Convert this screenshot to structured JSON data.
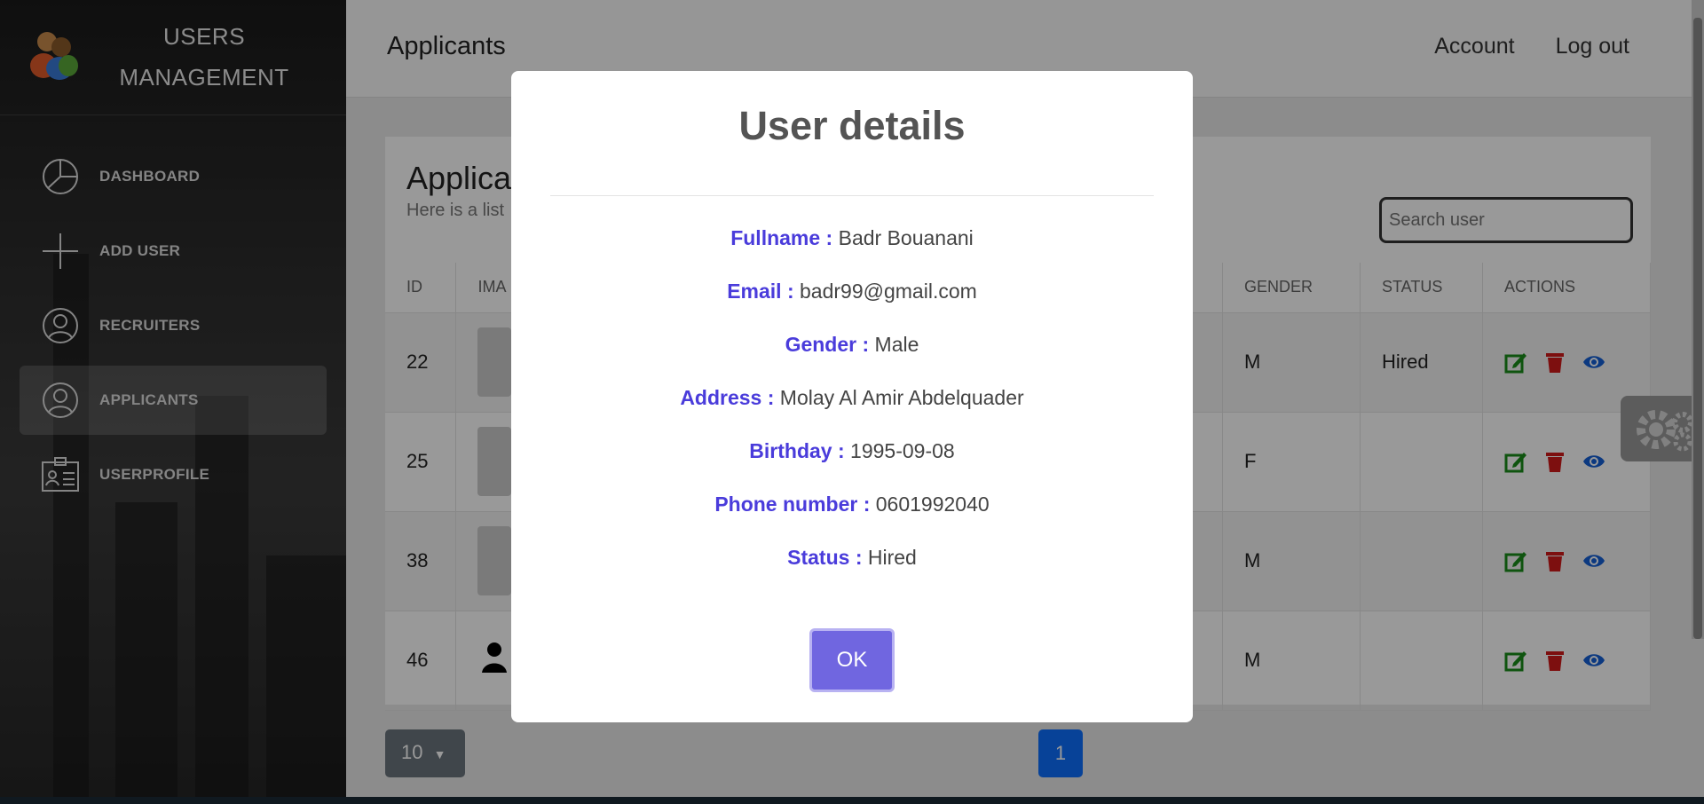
{
  "brand": {
    "line1": "USERS",
    "line2": "MANAGEMENT",
    "logo_icon": "users-group-icon"
  },
  "sidebar": {
    "items": [
      {
        "label": "DASHBOARD",
        "icon": "pie-chart-icon",
        "active": false
      },
      {
        "label": "ADD USER",
        "icon": "plus-icon",
        "active": false
      },
      {
        "label": "RECRUITERS",
        "icon": "user-circle-icon",
        "active": false
      },
      {
        "label": "APPLICANTS",
        "icon": "user-circle-icon",
        "active": true
      },
      {
        "label": "USERPROFILE",
        "icon": "id-card-icon",
        "active": false
      }
    ]
  },
  "header": {
    "title": "Applicants",
    "account": "Account",
    "logout": "Log out"
  },
  "card": {
    "title": "Applica",
    "subtitle": "Here is a list",
    "search_placeholder": "Search user"
  },
  "table": {
    "columns": [
      "ID",
      "IMA",
      "GENDER",
      "STATUS",
      "ACTIONS"
    ],
    "rows": [
      {
        "id": "22",
        "gender": "M",
        "status": "Hired"
      },
      {
        "id": "25",
        "gender": "F",
        "status": ""
      },
      {
        "id": "38",
        "gender": "M",
        "status": ""
      },
      {
        "id": "46",
        "gender": "M",
        "status": ""
      }
    ],
    "action_icons": [
      "edit-icon",
      "trash-icon",
      "eye-icon"
    ]
  },
  "pagination": {
    "page_size": "10",
    "current_page": "1"
  },
  "modal": {
    "title": "User details",
    "fields": [
      {
        "label": "Fullname :",
        "value": "Badr Bouanani"
      },
      {
        "label": "Email :",
        "value": "badr99@gmail.com"
      },
      {
        "label": "Gender :",
        "value": "Male"
      },
      {
        "label": "Address :",
        "value": "Molay Al Amir Abdelquader"
      },
      {
        "label": "Birthday :",
        "value": "1995-09-08"
      },
      {
        "label": "Phone number :",
        "value": "0601992040"
      },
      {
        "label": "Status :",
        "value": "Hired"
      }
    ],
    "ok_label": "OK"
  },
  "colors": {
    "modal_label": "#4a3cdb",
    "ok_button": "#7066e0",
    "edit_icon": "#1a8c1a",
    "delete_icon": "#d11a1a",
    "view_icon": "#1560d6",
    "page_button": "#0d6efd"
  }
}
